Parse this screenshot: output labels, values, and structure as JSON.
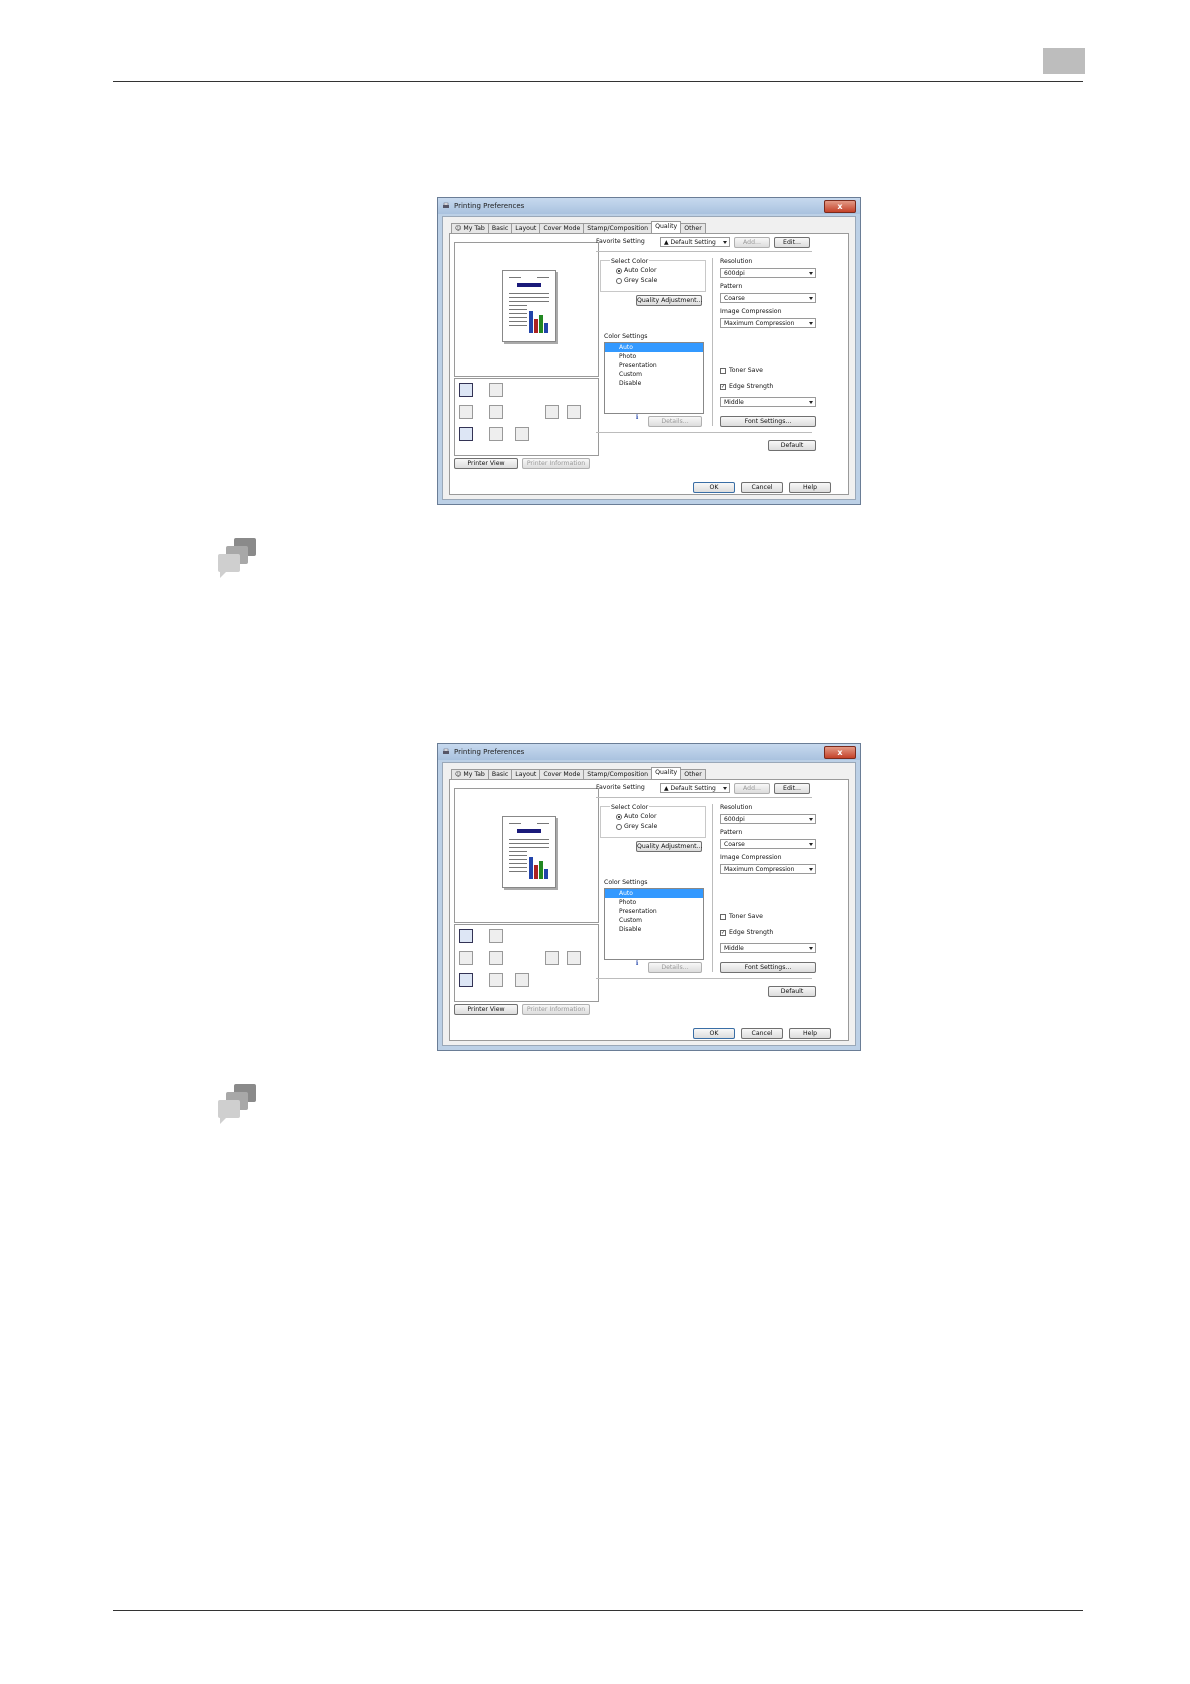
{
  "dialog": {
    "title": "Printing Preferences",
    "close_label": "x",
    "tabs": [
      "My Tab",
      "Basic",
      "Layout",
      "Cover Mode",
      "Stamp/Composition",
      "Quality",
      "Other"
    ],
    "favorite_label": "Favorite Setting",
    "favorite_value": "Default Setting",
    "add_label": "Add...",
    "edit_label": "Edit...",
    "select_color_label": "Select Color",
    "auto_color_label": "Auto Color",
    "grey_scale_label": "Grey Scale",
    "quality_adjustment_label": "Quality Adjustment...",
    "color_settings_label": "Color Settings",
    "color_settings_items": [
      "Auto",
      "Photo",
      "Presentation",
      "Custom",
      "Disable"
    ],
    "details_label": "Details...",
    "resolution_label": "Resolution",
    "resolution_value": "600dpi",
    "pattern_label": "Pattern",
    "pattern_value": "Coarse",
    "image_compression_label": "Image Compression",
    "image_compression_value": "Maximum Compression",
    "toner_save_label": "Toner Save",
    "edge_strength_label": "Edge Strength",
    "edge_strength_value": "Middle",
    "font_settings_label": "Font Settings...",
    "printer_view_label": "Printer View",
    "printer_information_label": "Printer Information",
    "default_label": "Default",
    "ok_label": "OK",
    "cancel_label": "Cancel",
    "help_label": "Help",
    "colors": {
      "selection": "#3399ff",
      "titlebar": "#bcd0e6",
      "close": "#c4422a"
    }
  }
}
